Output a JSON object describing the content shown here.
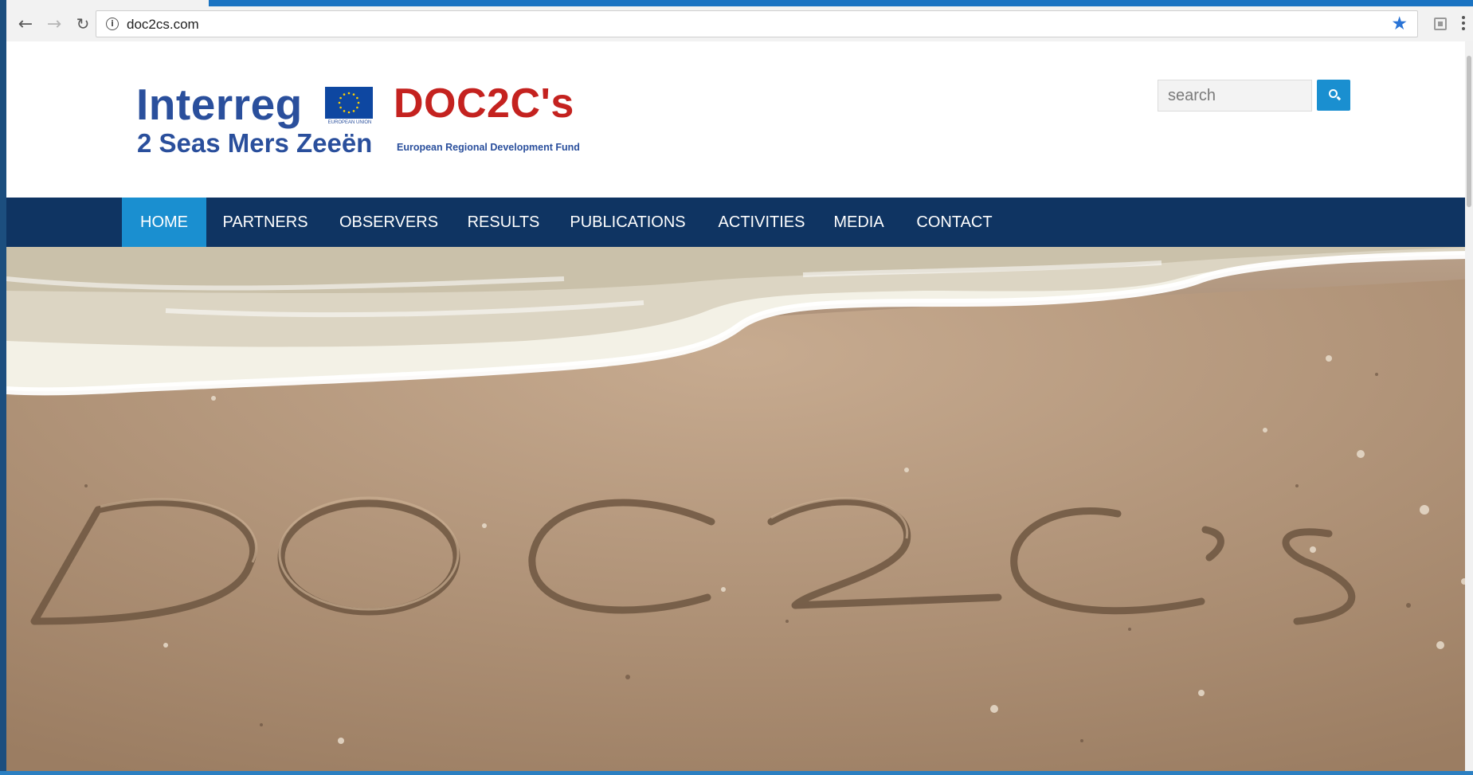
{
  "browser": {
    "url": "doc2cs.com",
    "back_icon": "←",
    "forward_icon": "→",
    "reload_icon": "↻",
    "info_icon": "i",
    "star_icon": "★"
  },
  "header": {
    "logo_interreg": "Interreg",
    "logo_subtitle": "2 Seas Mers Zeeën",
    "eu_caption": "EUROPEAN UNION",
    "logo_project": "DOC2C's",
    "logo_fund": "European Regional Development Fund",
    "search": {
      "placeholder": "search"
    }
  },
  "nav": {
    "items": [
      {
        "label": "HOME",
        "active": true
      },
      {
        "label": "PARTNERS"
      },
      {
        "label": "OBSERVERS"
      },
      {
        "label": "RESULTS"
      },
      {
        "label": "PUBLICATIONS"
      },
      {
        "label": "ACTIVITIES"
      },
      {
        "label": "MEDIA"
      },
      {
        "label": "CONTACT"
      }
    ]
  },
  "colors": {
    "nav_bg": "#0f3462",
    "nav_active": "#1a8fd0",
    "brand_blue": "#2a4f9c",
    "brand_red": "#c4221f"
  }
}
